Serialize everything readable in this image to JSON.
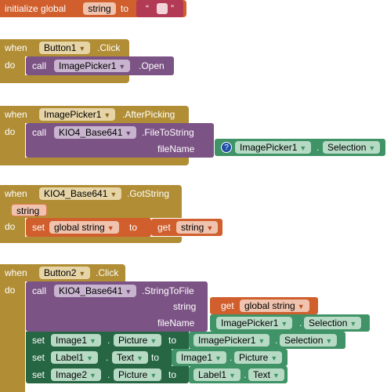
{
  "global": {
    "prefix": "initialize global",
    "name": "string",
    "to": "to",
    "open_quote": "“",
    "close_quote": "”"
  },
  "b1": {
    "when": "when",
    "component": "Button1",
    "event": ".Click",
    "do": "do",
    "call": "call",
    "target": "ImagePicker1",
    "method": ".Open"
  },
  "b2": {
    "when": "when",
    "component": "ImagePicker1",
    "event": ".AfterPicking",
    "do": "do",
    "call": "call",
    "target": "KIO4_Base641",
    "method": ".FileToString",
    "param": "fileName",
    "arg_comp": "ImagePicker1",
    "dot": ".",
    "arg_prop": "Selection"
  },
  "b3": {
    "when": "when",
    "component": "KIO4_Base641",
    "event": ".GotString",
    "param": "string",
    "do": "do",
    "set": "set",
    "var": "global string",
    "to": "to",
    "get": "get",
    "get_var": "string"
  },
  "b4": {
    "when": "when",
    "component": "Button2",
    "event": ".Click",
    "do": "do",
    "call": "call",
    "target": "KIO4_Base641",
    "method": ".StringToFile",
    "param1": "string",
    "get": "get",
    "get_var": "global string",
    "param2": "fileName",
    "arg_comp": "ImagePicker1",
    "dot": ".",
    "arg_prop": "Selection",
    "rows": [
      {
        "set": "set",
        "comp": "Image1",
        "dot": ".",
        "prop": "Picture",
        "to": "to",
        "vcomp": "ImagePicker1",
        "vdot": ".",
        "vprop": "Selection"
      },
      {
        "set": "set",
        "comp": "Label1",
        "dot": ".",
        "prop": "Text",
        "to": "to",
        "vcomp": "Image1",
        "vdot": ".",
        "vprop": "Picture"
      },
      {
        "set": "set",
        "comp": "Image2",
        "dot": ".",
        "prop": "Picture",
        "to": "to",
        "vcomp": "Label1",
        "vdot": ".",
        "vprop": "Text"
      }
    ]
  },
  "dropdown_glyph": "▼",
  "help_glyph": "?"
}
